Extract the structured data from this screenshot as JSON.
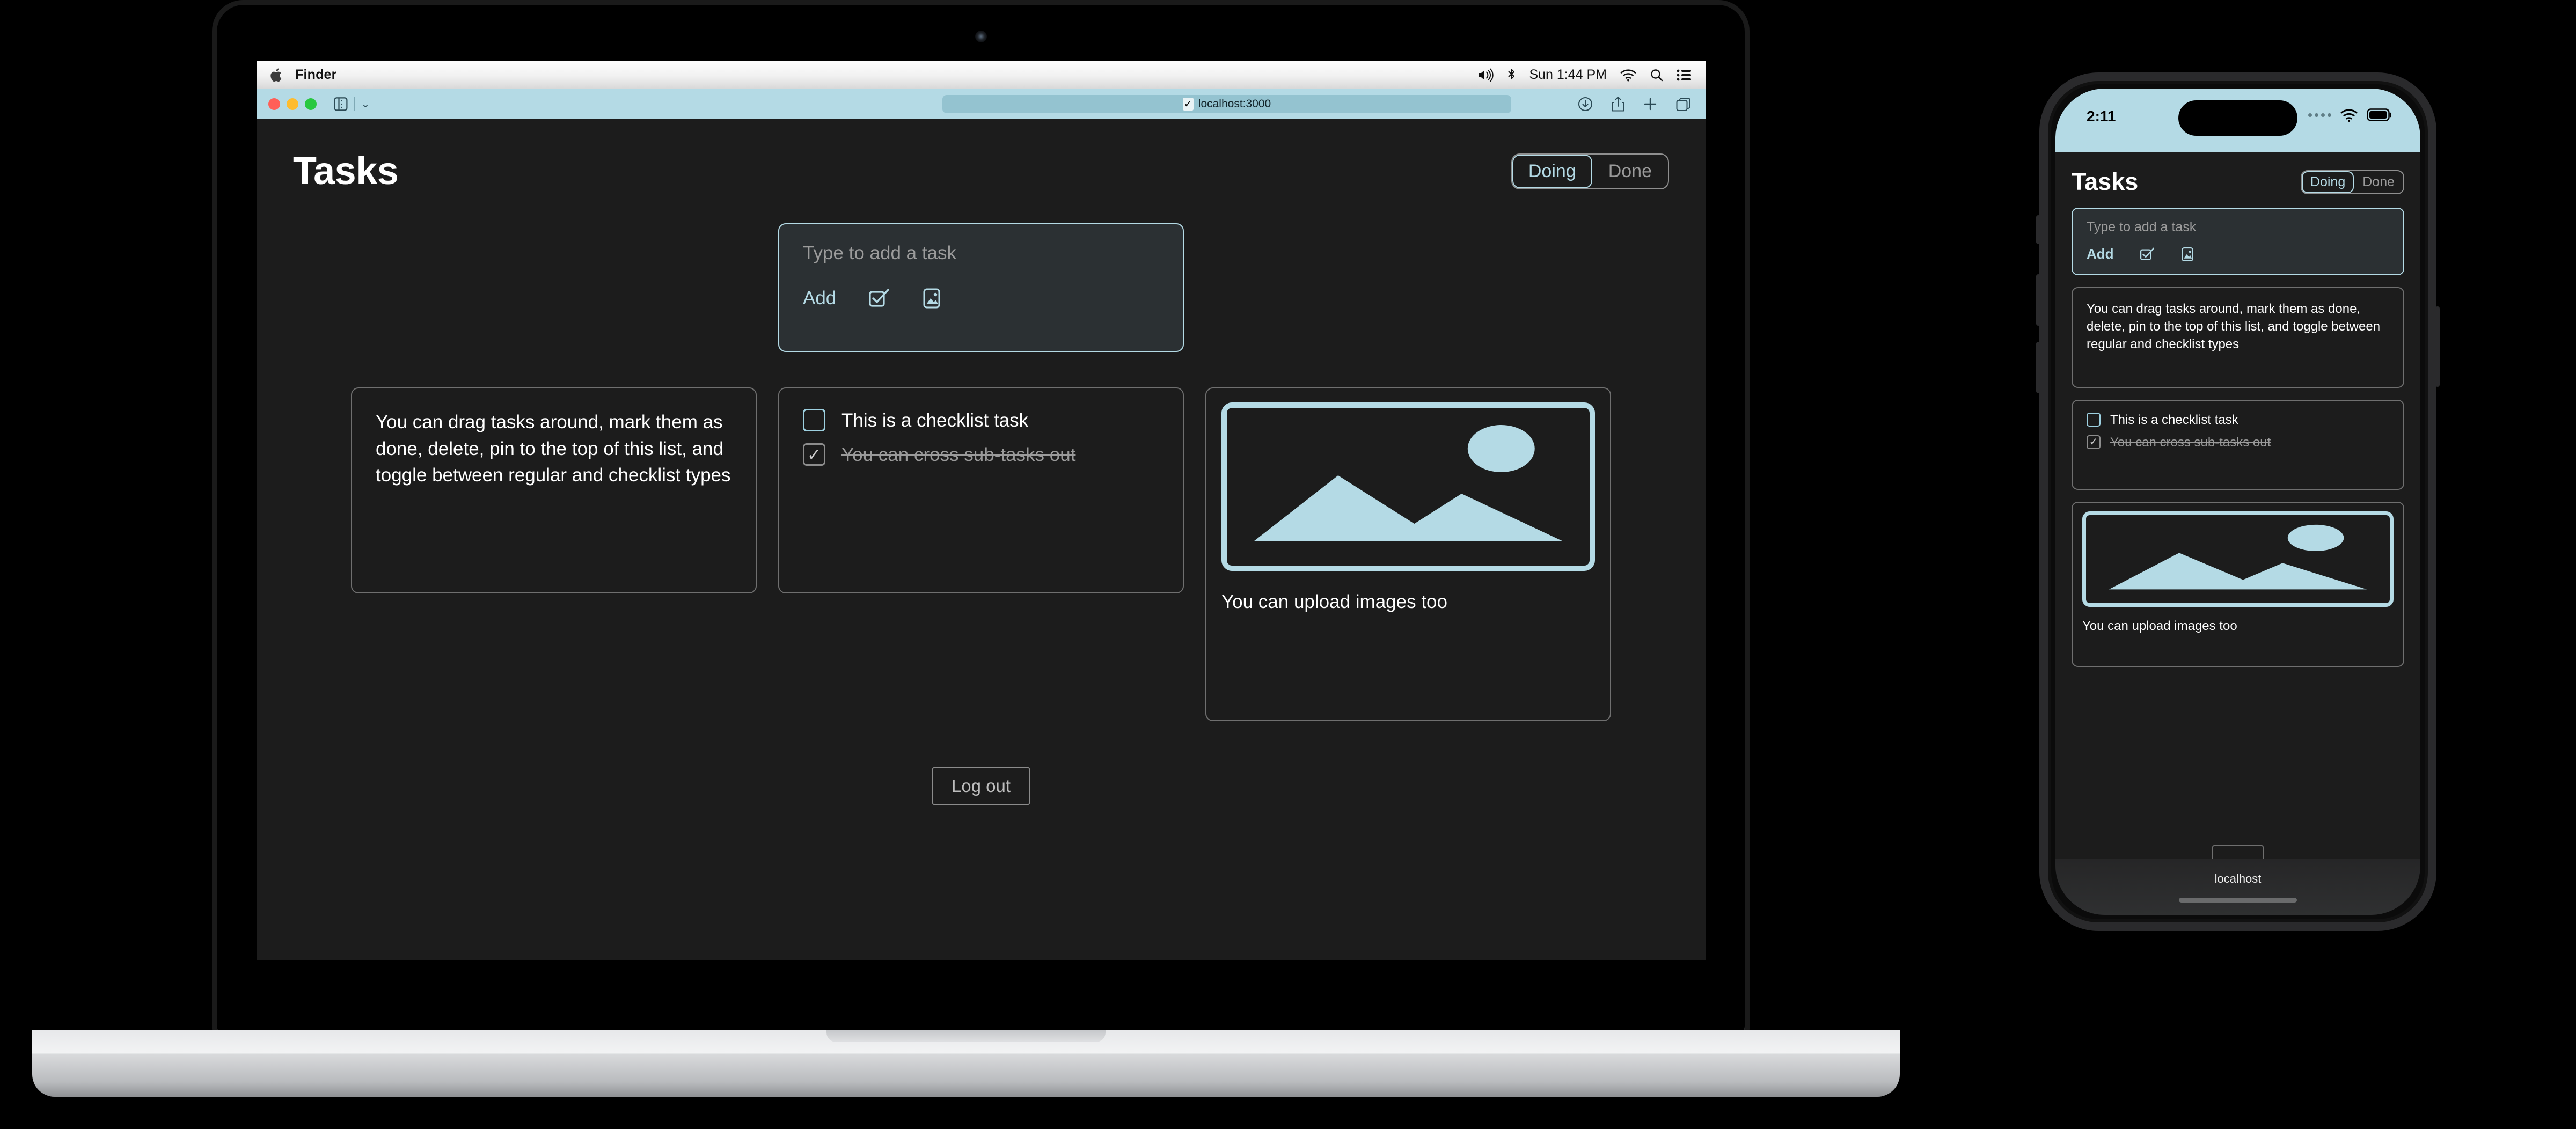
{
  "desktop": {
    "menubar": {
      "apple_icon": "apple-logo-icon",
      "app_name": "Finder",
      "volume_icon": "volume-icon",
      "bluetooth_icon": "bluetooth-icon",
      "clock": "Sun 1:44 PM",
      "wifi_icon": "wifi-icon",
      "search_icon": "spotlight-search-icon",
      "control_center_icon": "control-center-icon"
    },
    "browser": {
      "traffic_lights": [
        "close-button",
        "minimize-button",
        "zoom-button"
      ],
      "sidebar_icon": "sidebar-toggle-icon",
      "chevron": "⌄",
      "url": "localhost:3000",
      "url_check_icon": "✓",
      "download_icon": "download-icon",
      "share_icon": "share-icon",
      "newtab_icon": "new-tab-icon",
      "tabs_icon": "tab-overview-icon"
    },
    "app": {
      "title": "Tasks",
      "segments": [
        {
          "label": "Doing",
          "active": true
        },
        {
          "label": "Done",
          "active": false
        }
      ],
      "add_card": {
        "placeholder": "Type to add a task",
        "add_label": "Add",
        "checklist_icon": "checklist-toggle-icon",
        "image_icon": "image-upload-icon"
      },
      "tasks": [
        {
          "type": "text",
          "text": "You can drag tasks around, mark them as done, delete, pin to the top of this list, and toggle between regular and checklist types"
        },
        {
          "type": "checklist",
          "items": [
            {
              "label": "This is a checklist task",
              "checked": false
            },
            {
              "label": "You can cross sub-tasks out",
              "checked": true
            }
          ]
        },
        {
          "type": "image",
          "image_icon": "image-placeholder-icon",
          "caption": "You can upload images too"
        }
      ],
      "logout_label": "Log out"
    }
  },
  "phone": {
    "status": {
      "time": "2:11",
      "signal_icon": "cellular-signal-icon",
      "wifi_icon": "wifi-icon",
      "battery_icon": "battery-icon"
    },
    "app": {
      "title": "Tasks",
      "segments": [
        {
          "label": "Doing",
          "active": true
        },
        {
          "label": "Done",
          "active": false
        }
      ],
      "add_card": {
        "placeholder": "Type to add a task",
        "add_label": "Add",
        "checklist_icon": "checklist-toggle-icon",
        "image_icon": "image-upload-icon"
      },
      "tasks": [
        {
          "type": "text",
          "text": "You can drag tasks around, mark them as done, delete, pin to the top of this list, and toggle between regular and checklist types"
        },
        {
          "type": "checklist",
          "items": [
            {
              "label": "This is a checklist task",
              "checked": false
            },
            {
              "label": "You can cross sub-tasks out",
              "checked": true
            }
          ]
        },
        {
          "type": "image",
          "image_icon": "image-placeholder-icon",
          "caption": "You can upload images too"
        }
      ]
    },
    "browser_bar": {
      "url": "localhost"
    }
  },
  "colors": {
    "accent": "#b4dae5",
    "background": "#1c1c1c",
    "card_border": "#6f6f6f",
    "muted_text": "#9a9a9a",
    "input_bg": "#2b3033"
  }
}
